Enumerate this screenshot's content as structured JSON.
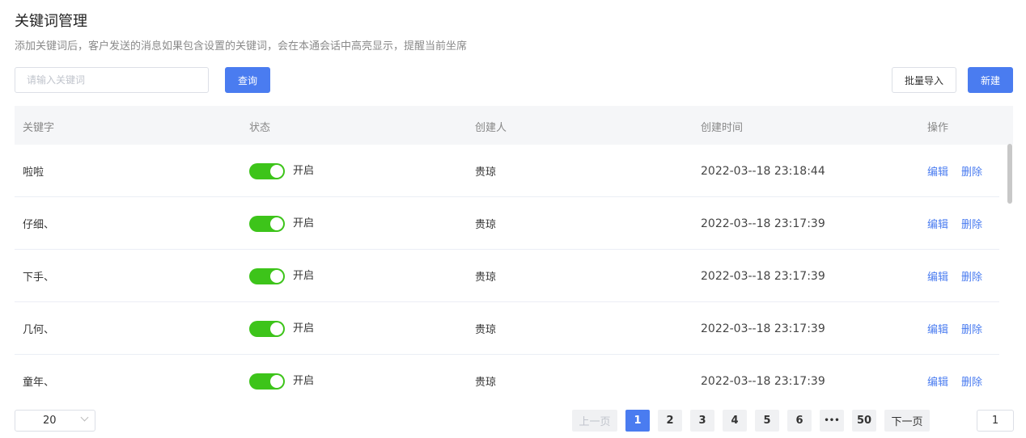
{
  "header": {
    "title": "关键词管理",
    "description": "添加关键词后，客户发送的消息如果包含设置的关键词，会在本通会话中高亮显示，提醒当前坐席"
  },
  "toolbar": {
    "search_placeholder": "请输入关键词",
    "search_value": "",
    "query_label": "查询",
    "import_label": "批量导入",
    "new_label": "新建"
  },
  "table": {
    "columns": [
      "关键字",
      "状态",
      "创建人",
      "创建时间",
      "操作"
    ],
    "rows": [
      {
        "keyword": "啦啦",
        "status": "开启",
        "enabled": true,
        "creator": "贵琼",
        "created_at": "2022-03--18 23:18:44"
      },
      {
        "keyword": "仔细、",
        "status": "开启",
        "enabled": true,
        "creator": "贵琼",
        "created_at": "2022-03--18 23:17:39"
      },
      {
        "keyword": "下手、",
        "status": "开启",
        "enabled": true,
        "creator": "贵琼",
        "created_at": "2022-03--18 23:17:39"
      },
      {
        "keyword": "几何、",
        "status": "开启",
        "enabled": true,
        "creator": "贵琼",
        "created_at": "2022-03--18 23:17:39"
      },
      {
        "keyword": "童年、",
        "status": "开启",
        "enabled": true,
        "creator": "贵琼",
        "created_at": "2022-03--18 23:17:39"
      }
    ],
    "edit_label": "编辑",
    "delete_label": "删除"
  },
  "pagination": {
    "page_size": "20",
    "prev_label": "上一页",
    "next_label": "下一页",
    "pages": [
      "1",
      "2",
      "3",
      "4",
      "5",
      "6",
      "•••",
      "50"
    ],
    "current_page": "1",
    "jump_value": "1"
  },
  "colors": {
    "primary": "#4a7cf0",
    "switch_on": "#3dc41a"
  }
}
